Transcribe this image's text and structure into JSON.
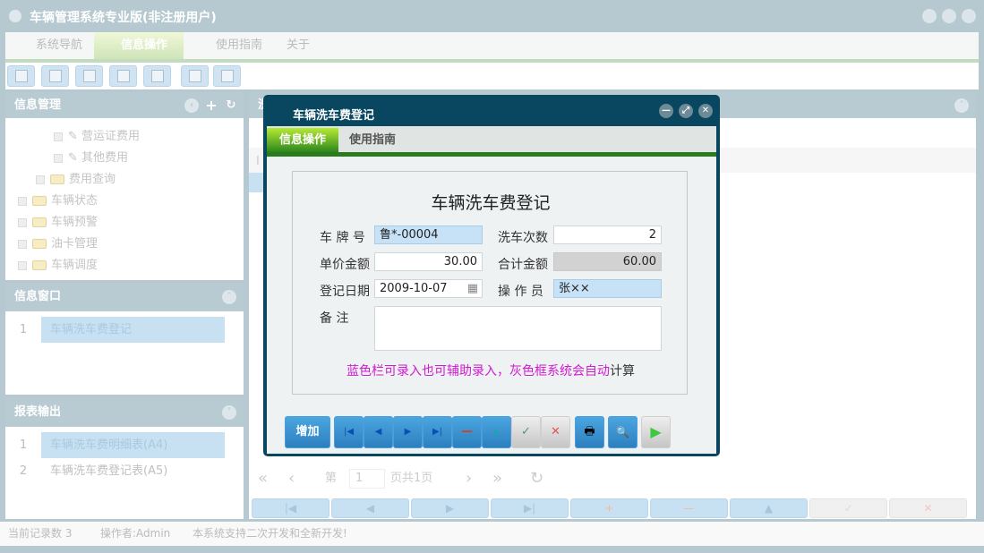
{
  "window": {
    "title": "车辆管理系统专业版(非注册用户)"
  },
  "menu": [
    {
      "label": "系统导航"
    },
    {
      "label": "信息操作"
    },
    {
      "label": "使用指南"
    },
    {
      "label": "关于"
    }
  ],
  "left": {
    "info_mgmt": {
      "title": "信息管理",
      "tree": [
        "营运证费用",
        "其他费用",
        "费用查询",
        "车辆状态",
        "车辆预警",
        "油卡管理",
        "车辆调度"
      ]
    },
    "info_window": {
      "title": "信息窗口",
      "items": [
        {
          "n": "1",
          "label": "车辆洗车费登记"
        }
      ]
    },
    "reports": {
      "title": "报表输出",
      "items": [
        {
          "n": "1",
          "label": "车辆洗车费明细表(A4)"
        },
        {
          "n": "2",
          "label": "车辆洗车费登记表(A5)"
        }
      ]
    }
  },
  "right": {
    "header_partial": "洗",
    "col_partial": "I",
    "pager": {
      "page_label": "第",
      "page": "1",
      "total": "页共1页"
    },
    "bottom_buttons": [
      "|◀",
      "◀",
      "▶",
      "▶|",
      "+",
      "—",
      "▲",
      "✓",
      "✕"
    ]
  },
  "status": {
    "records": "当前记录数 3",
    "operator": "操作者:Admin",
    "note": "本系统支持二次开发和全新开发!"
  },
  "modal": {
    "title": "车辆洗车费登记",
    "tabs": [
      "信息操作",
      "使用指南"
    ],
    "form_title": "车辆洗车费登记",
    "fields": {
      "plate": {
        "label": "车 牌 号",
        "value": "鲁*-00004"
      },
      "wash_count": {
        "label": "洗车次数",
        "value": "2"
      },
      "unit_price": {
        "label": "单价金额",
        "value": "30.00"
      },
      "total": {
        "label": "合计金额",
        "value": "60.00"
      },
      "date": {
        "label": "登记日期",
        "value": "2009-10-07"
      },
      "operator": {
        "label": "操 作 员",
        "value": "张××"
      },
      "remark": {
        "label": "备 注",
        "value": ""
      }
    },
    "hint": {
      "p1": "蓝色栏可录入也可辅助录入，",
      "p2": "灰色框系统会自动",
      "p3": "计算"
    },
    "buttons": {
      "add": "增加",
      "first": "|◀",
      "prev": "◀",
      "next": "▶",
      "last": "▶|",
      "delete": "—",
      "up": "▲",
      "ok": "✓",
      "cancel": "✕",
      "print": "🖶",
      "preview": "🔍",
      "run": "▶"
    }
  },
  "colors": {
    "modal_header": "#08475f",
    "accent_green": "#2a7a1e",
    "input_blue": "#c7e1f7"
  }
}
